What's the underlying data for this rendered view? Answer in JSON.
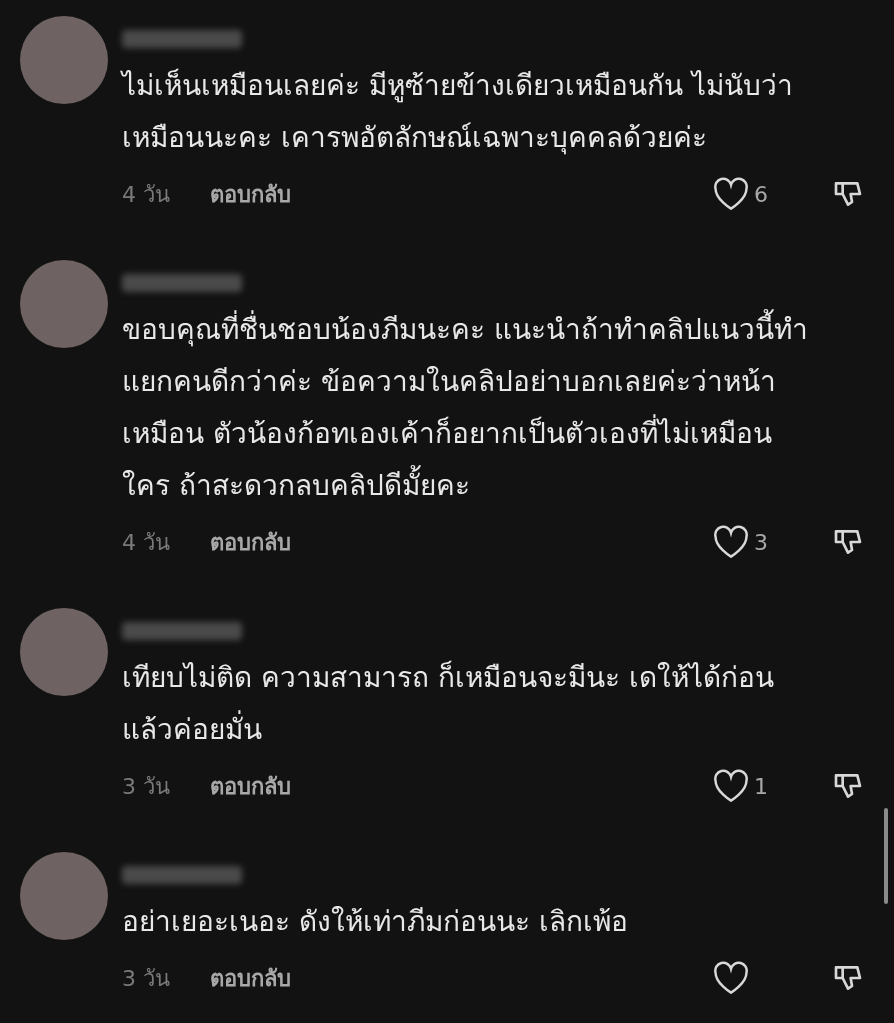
{
  "comments": [
    {
      "text_lines": [
        "ไม่เห็นเหมือนเลยค่ะ มีหูซ้ายข้างเดียวเหมือนกัน ไม่นับว่า",
        "เหมือนนะคะ เคารพอัตลักษณ์เฉพาะบุคคลด้วยค่ะ"
      ],
      "time": "4 วัน",
      "reply": "ตอบกลับ",
      "likes": "6",
      "liked": false
    },
    {
      "text_lines": [
        "ขอบคุณที่ชื่นชอบน้องภีมนะคะ แนะนำถ้าทำคลิปแนวนี้ทำ",
        "แยกคนดีกว่าค่ะ ข้อความในคลิปอย่าบอกเลยค่ะว่าหน้า",
        "เหมือน ตัวน้องก้อทเองเค้าก็อยากเป็นตัวเองที่ไม่เหมือน",
        "ใคร ถ้าสะดวกลบคลิปดีมั้ยคะ"
      ],
      "time": "4 วัน",
      "reply": "ตอบกลับ",
      "likes": "3",
      "liked": false
    },
    {
      "text_lines": [
        "เทียบไม่ติด ความสามารถ ก็เหมือนจะมีนะ  เดให้ได้ก่อน",
        "แล้วค่อยมั่น"
      ],
      "time": "3 วัน",
      "reply": "ตอบกลับ",
      "likes": "1",
      "liked": false
    },
    {
      "text_lines": [
        "อย่าเยอะเนอะ ดังให้เท่าภีมก่อนนะ เลิกเพ้อ"
      ],
      "time": "3 วัน",
      "reply": "ตอบกลับ",
      "liked": false
    }
  ]
}
